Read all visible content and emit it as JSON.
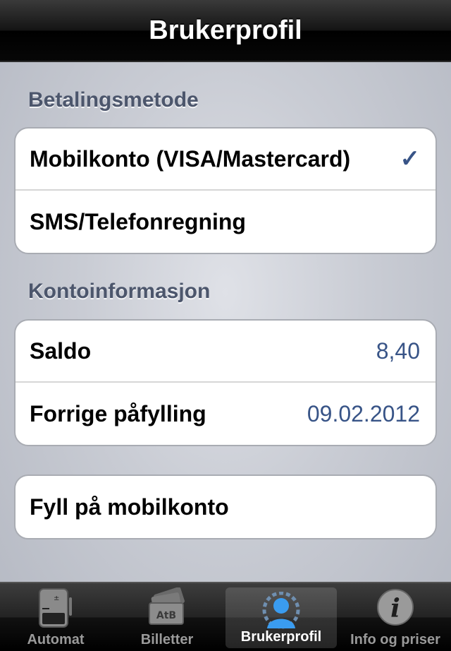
{
  "navbar": {
    "title": "Brukerprofil"
  },
  "payment": {
    "header": "Betalingsmetode",
    "options": [
      {
        "label": "Mobilkonto (VISA/Mastercard)",
        "selected": true,
        "check": "✓"
      },
      {
        "label": "SMS/Telefonregning",
        "selected": false
      }
    ]
  },
  "account": {
    "header": "Kontoinformasjon",
    "rows": [
      {
        "label": "Saldo",
        "value": "8,40"
      },
      {
        "label": "Forrige påfylling",
        "value": "09.02.2012"
      }
    ]
  },
  "topup": {
    "label": "Fyll på mobilkonto"
  },
  "tabbar": {
    "tabs": [
      {
        "label": "Automat",
        "icon": "ticket-machine-icon",
        "active": false
      },
      {
        "label": "Billetter",
        "icon": "tickets-icon",
        "icon_text": "AtB",
        "active": false
      },
      {
        "label": "Brukerprofil",
        "icon": "user-profile-icon",
        "active": true
      },
      {
        "label": "Info og priser",
        "icon": "info-icon",
        "icon_text": "i",
        "active": false
      }
    ]
  },
  "colors": {
    "accent": "#385487",
    "header_text": "#4c566c"
  }
}
